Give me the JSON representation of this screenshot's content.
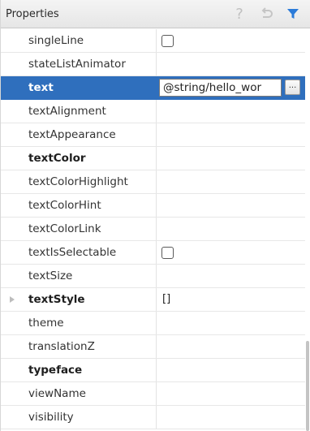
{
  "panel": {
    "title": "Properties",
    "help_icon": "help-icon",
    "undo_icon": "restore-icon",
    "filter_icon": "filter-icon",
    "accent_color": "#2f6fbd",
    "filter_color": "#2b7bd9"
  },
  "properties": [
    {
      "name": "singleLine",
      "value_type": "checkbox",
      "checked": false
    },
    {
      "name": "stateListAnimator",
      "value": ""
    },
    {
      "name": "text",
      "value": "@string/hello_wor",
      "selected": true,
      "ellipsis_label": "..."
    },
    {
      "name": "textAlignment",
      "value": ""
    },
    {
      "name": "textAppearance",
      "value": ""
    },
    {
      "name": "textColor",
      "value": "",
      "bold": true
    },
    {
      "name": "textColorHighlight",
      "value": ""
    },
    {
      "name": "textColorHint",
      "value": ""
    },
    {
      "name": "textColorLink",
      "value": ""
    },
    {
      "name": "textIsSelectable",
      "value_type": "checkbox",
      "checked": false
    },
    {
      "name": "textSize",
      "value": ""
    },
    {
      "name": "textStyle",
      "value": "[]",
      "bold": true,
      "expandable": true
    },
    {
      "name": "theme",
      "value": ""
    },
    {
      "name": "translationZ",
      "value": ""
    },
    {
      "name": "typeface",
      "value": "",
      "bold": true
    },
    {
      "name": "viewName",
      "value": ""
    },
    {
      "name": "visibility",
      "value": ""
    }
  ]
}
